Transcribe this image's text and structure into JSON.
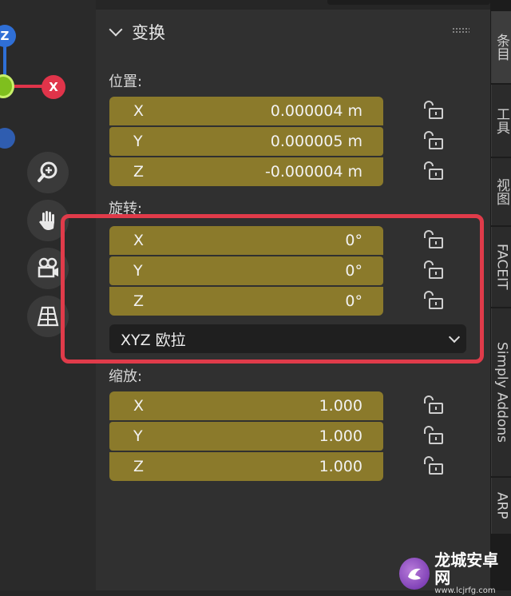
{
  "section": {
    "title": "变换",
    "expanded": true
  },
  "location": {
    "label": "位置:",
    "fields": [
      {
        "axis": "X",
        "value": "0.000004 m"
      },
      {
        "axis": "Y",
        "value": "0.000005 m"
      },
      {
        "axis": "Z",
        "value": "-0.000004 m"
      }
    ]
  },
  "rotation": {
    "label": "旋转:",
    "fields": [
      {
        "axis": "X",
        "value": "0°"
      },
      {
        "axis": "Y",
        "value": "0°"
      },
      {
        "axis": "Z",
        "value": "0°"
      }
    ],
    "mode": "XYZ 欧拉"
  },
  "scale": {
    "label": "缩放:",
    "fields": [
      {
        "axis": "X",
        "value": "1.000"
      },
      {
        "axis": "Y",
        "value": "1.000"
      },
      {
        "axis": "Z",
        "value": "1.000"
      }
    ]
  },
  "sidebar_tabs": [
    "条目",
    "工具",
    "视图",
    "FACEIT",
    "Simply Addons",
    "ARP"
  ],
  "gizmo": {
    "z_label": "Z",
    "x_label": "X"
  },
  "watermark": {
    "title": "龙城安卓网",
    "url": "www.lcjrfg.com"
  },
  "colors": {
    "field": "#8b7a2b",
    "highlight": "#e03b4a",
    "x_axis": "#e0344a",
    "y_axis": "#7fbf1e",
    "z_axis": "#2f6fd6"
  }
}
